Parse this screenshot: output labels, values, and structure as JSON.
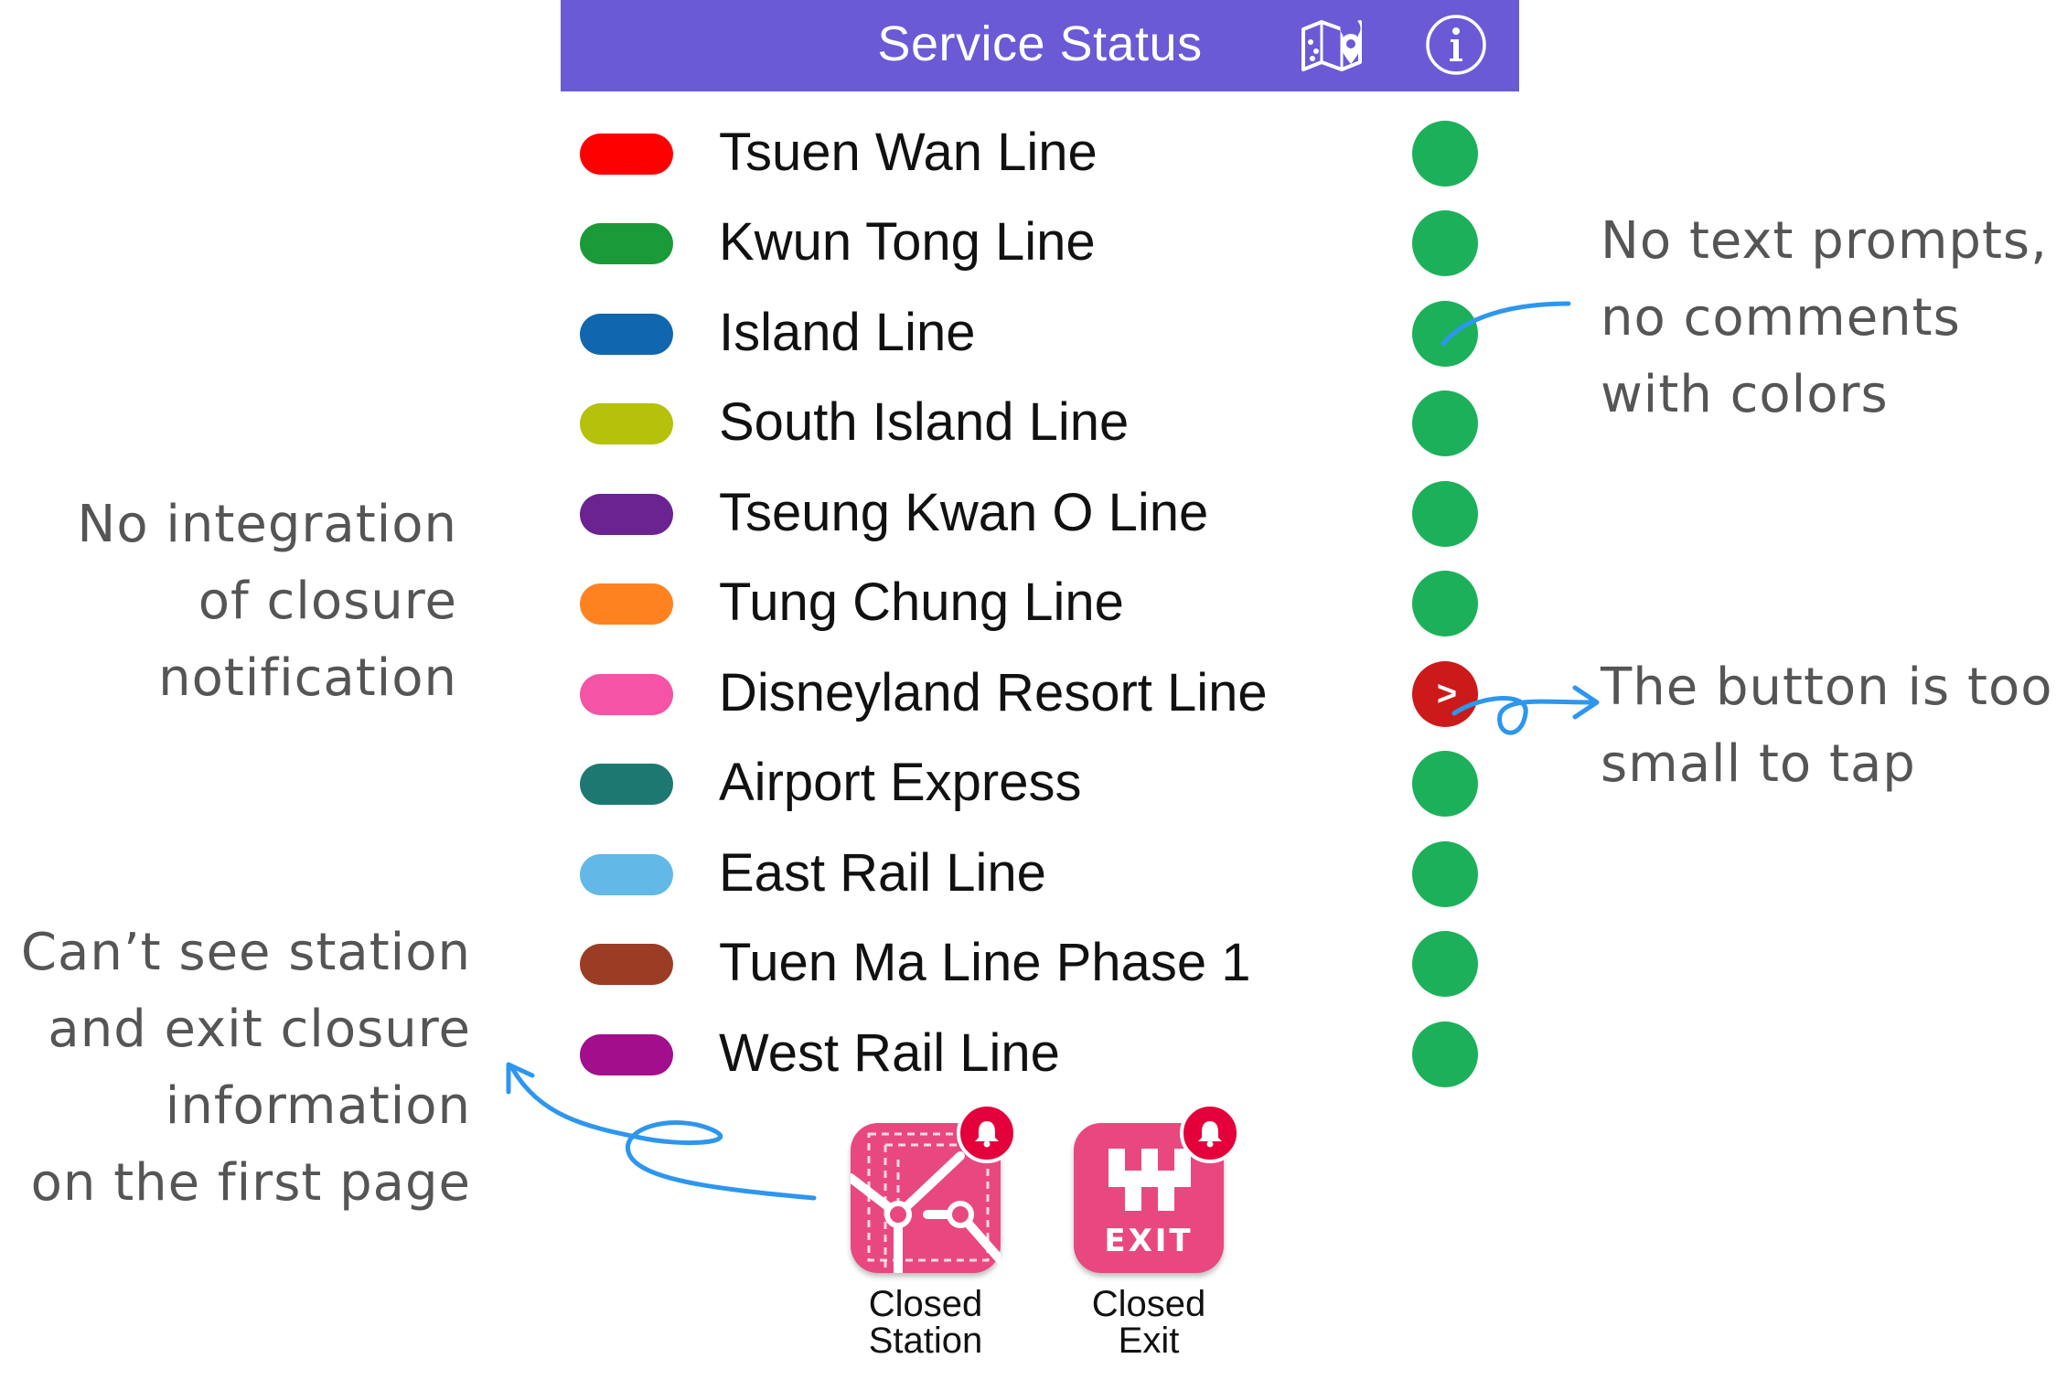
{
  "app": {
    "title": "Service Status",
    "header_color": "#6a5ad6",
    "icons": {
      "map": "map-pin-icon",
      "info": "info-icon"
    }
  },
  "lines": [
    {
      "name": "Tsuen Wan Line",
      "color": "#ff0000",
      "status": "normal"
    },
    {
      "name": "Kwun Tong Line",
      "color": "#1a9a39",
      "status": "normal"
    },
    {
      "name": "Island Line",
      "color": "#1166b0",
      "status": "normal"
    },
    {
      "name": "South Island Line",
      "color": "#b5c10a",
      "status": "normal"
    },
    {
      "name": "Tseung Kwan O Line",
      "color": "#6a2390",
      "status": "normal"
    },
    {
      "name": "Tung Chung Line",
      "color": "#ff8221",
      "status": "normal"
    },
    {
      "name": "Disneyland Resort Line",
      "color": "#f553a6",
      "status": "alert"
    },
    {
      "name": "Airport Express",
      "color": "#1c7870",
      "status": "normal"
    },
    {
      "name": "East Rail Line",
      "color": "#62b8e6",
      "status": "normal"
    },
    {
      "name": "Tuen Ma Line Phase 1",
      "color": "#9b3c24",
      "status": "normal"
    },
    {
      "name": "West Rail Line",
      "color": "#a20e8c",
      "status": "normal"
    }
  ],
  "status_colors": {
    "normal": "#1db05a",
    "alert": "#cc1a1a"
  },
  "alert_glyph": ">",
  "shortcuts": {
    "closed_station": {
      "label_line1": "Closed",
      "label_line2": "Station",
      "icon": "station-map-icon"
    },
    "closed_exit": {
      "label": "Closed Exit",
      "tile_text": "EXIT",
      "icon": "exit-icon"
    }
  },
  "annotations": {
    "integration": {
      "lines": [
        "No integration",
        "of closure",
        "notification"
      ]
    },
    "closure_info": {
      "lines": [
        "Can’t see station",
        "and exit closure",
        "information",
        "on the first page"
      ]
    },
    "text_prompts": {
      "lines": [
        "No text prompts,",
        "no comments",
        "with colors"
      ]
    },
    "button_size": {
      "lines": [
        "The button is too",
        "small to tap"
      ]
    }
  },
  "annotation_color": "#2d96ee"
}
